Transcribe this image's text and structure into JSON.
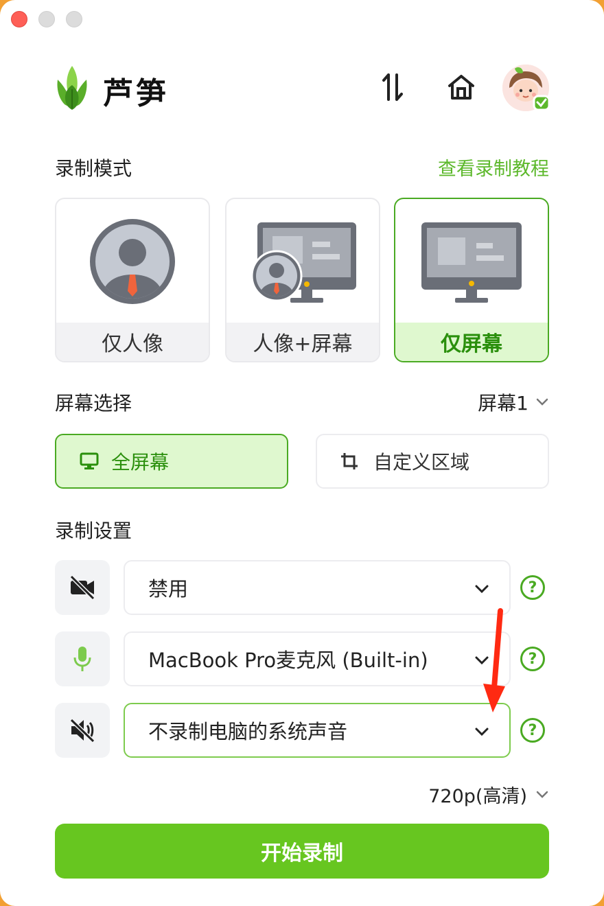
{
  "app": {
    "brand": "芦笋"
  },
  "recording_mode": {
    "title": "录制模式",
    "tutorial_link": "查看录制教程",
    "modes": [
      {
        "label": "仅人像",
        "selected": false
      },
      {
        "label": "人像+屏幕",
        "selected": false
      },
      {
        "label": "仅屏幕",
        "selected": true
      }
    ]
  },
  "screen_selection": {
    "title": "屏幕选择",
    "selected_screen": "屏幕1",
    "full_screen_label": "全屏幕",
    "custom_area_label": "自定义区域"
  },
  "recording_settings": {
    "title": "录制设置",
    "camera": {
      "value": "禁用",
      "icon": "camera-off-icon"
    },
    "microphone": {
      "value": "MacBook Pro麦克风 (Built-in)",
      "icon": "microphone-icon"
    },
    "system_audio": {
      "value": "不录制电脑的系统声音",
      "icon": "speaker-muted-icon"
    },
    "help_glyph": "?",
    "quality": "720p(高清)"
  },
  "start_button": "开始录制",
  "colors": {
    "accent": "#67c620",
    "accent_dark": "#2a8f0c",
    "selected_bg": "#dff8cf",
    "annotation_arrow": "#ff2a12"
  }
}
